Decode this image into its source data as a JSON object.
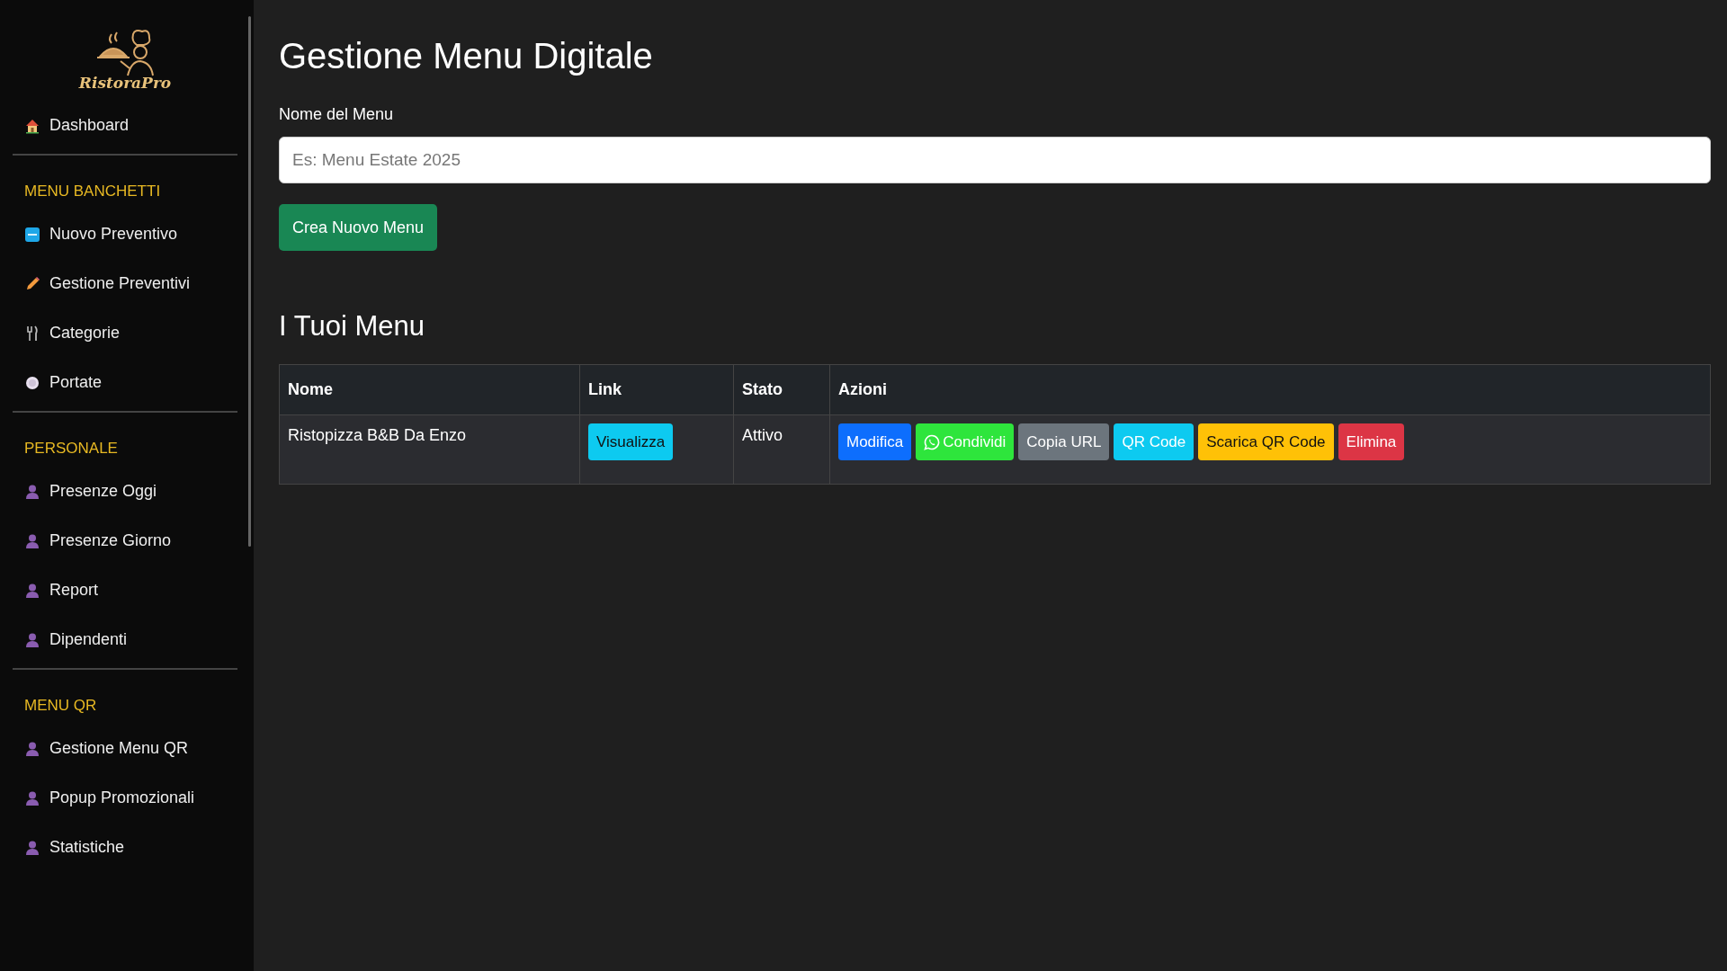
{
  "sidebar": {
    "logo_text": "RistoraPro",
    "top_items": [
      {
        "label": "Dashboard"
      }
    ],
    "sections": [
      {
        "title": "MENU BANCHETTI",
        "items": [
          {
            "label": "Nuovo Preventivo"
          },
          {
            "label": "Gestione Preventivi"
          },
          {
            "label": "Categorie"
          },
          {
            "label": "Portate"
          }
        ]
      },
      {
        "title": "PERSONALE",
        "items": [
          {
            "label": "Presenze Oggi"
          },
          {
            "label": "Presenze Giorno"
          },
          {
            "label": "Report"
          },
          {
            "label": "Dipendenti"
          }
        ]
      },
      {
        "title": "MENU QR",
        "items": [
          {
            "label": "Gestione Menu QR"
          },
          {
            "label": "Popup Promozionali"
          },
          {
            "label": "Statistiche"
          }
        ]
      }
    ]
  },
  "page_title": "Gestione Menu Digitale",
  "form": {
    "label": "Nome del Menu",
    "placeholder": "Es: Menu Estate 2025",
    "submit": "Crea Nuovo Menu"
  },
  "list_title": "I Tuoi Menu",
  "table": {
    "columns": [
      "Nome",
      "Link",
      "Stato",
      "Azioni"
    ],
    "rows": [
      {
        "nome": "Ristopizza B&B Da Enzo",
        "link": "Visualizza",
        "stato": "Attivo",
        "actions": [
          {
            "label": "Modifica",
            "kind": "plain",
            "color": "#0d6efd"
          },
          {
            "label": "Condividi",
            "kind": "whatsapp",
            "color": "#2ee53c"
          },
          {
            "label": "Copia URL",
            "kind": "plain",
            "color": "#6c757d"
          },
          {
            "label": "QR Code",
            "kind": "plain",
            "color": "#0dcaf0"
          },
          {
            "label": "Scarica QR Code",
            "kind": "plain",
            "color": "#ffc107"
          },
          {
            "label": "Elimina",
            "kind": "plain",
            "color": "#dc3545"
          }
        ]
      }
    ]
  }
}
